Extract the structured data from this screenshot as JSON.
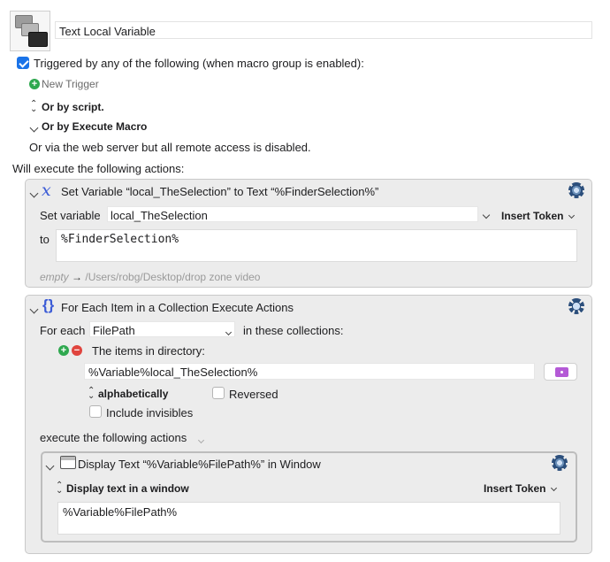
{
  "header": {
    "macro_name": "Text Local Variable"
  },
  "triggers": {
    "triggered_label": "Triggered by any of the following (when macro group is enabled):",
    "new_trigger": "New Trigger",
    "or_by_script": "Or by script.",
    "or_by_execute": "Or by Execute Macro",
    "web_server": "Or via the web server but all remote access is disabled."
  },
  "actions_heading": "Will execute the following actions:",
  "action1": {
    "title": "Set Variable “local_TheSelection” to Text “%FinderSelection%”",
    "set_variable_label": "Set variable",
    "variable_name": "local_TheSelection",
    "insert_token": "Insert Token",
    "to_label": "to",
    "to_value": "%FinderSelection%",
    "status_empty": "empty",
    "status_arrow": "→",
    "status_path": "/Users/robg/Desktop/drop zone video"
  },
  "action2": {
    "title": "For Each Item in a Collection Execute Actions",
    "for_each_label": "For each",
    "for_each_var": "FilePath",
    "in_collections": "in these collections:",
    "items_in_directory": "The items in directory:",
    "directory_value": "%Variable%local_TheSelection%",
    "sort_label": "alphabetically",
    "reversed_label": "Reversed",
    "include_invisibles": "Include invisibles",
    "execute_label": "execute the following actions"
  },
  "action3": {
    "title": "Display Text “%Variable%FilePath%” in Window",
    "mode_label": "Display text in a window",
    "insert_token": "Insert Token",
    "text_value": "%Variable%FilePath%"
  },
  "colors": {
    "accent": "#1a73e8",
    "add_green": "#2fa84f",
    "remove_red": "#e0443e",
    "folder_purple": "#b45ad6"
  }
}
